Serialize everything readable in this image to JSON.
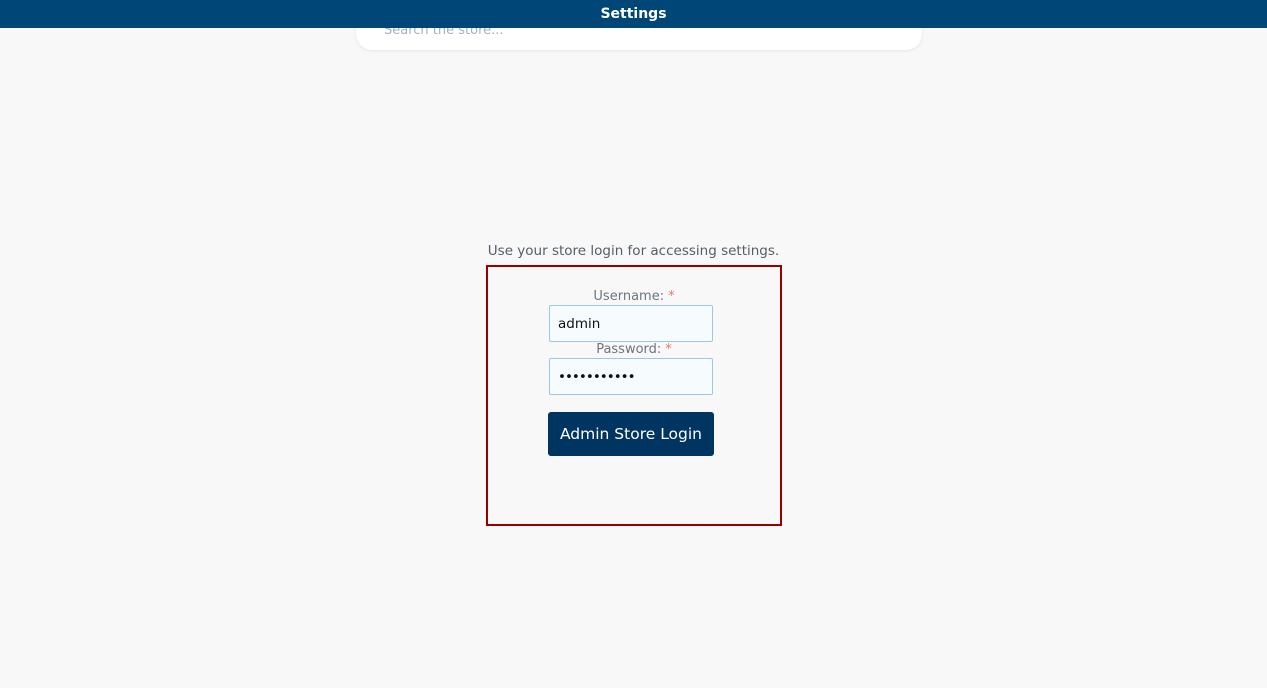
{
  "header": {
    "title": "Settings"
  },
  "search": {
    "placeholder": "Search the store..."
  },
  "login": {
    "hint": "Use your store login for accessing settings.",
    "username_label": "Username:",
    "username_value": "admin",
    "password_label": "Password:",
    "password_value": "•••••••••••",
    "required_mark": "*",
    "submit_label": "Admin Store Login"
  },
  "colors": {
    "header_bg": "#004677",
    "button_bg": "#003461",
    "highlight_border": "#990000",
    "required": "#e8796b"
  }
}
